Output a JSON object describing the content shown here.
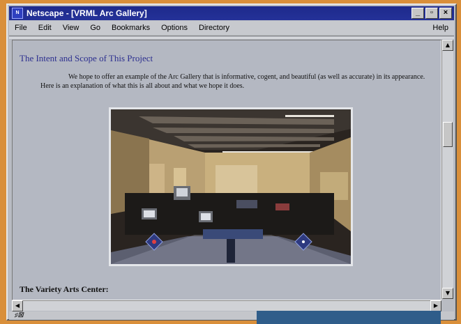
{
  "window": {
    "title": "Netscape - [VRML Arc Gallery]",
    "app_icon": "N",
    "controls": {
      "minimize": "_",
      "maximize": "▫",
      "close": "×"
    }
  },
  "menu": {
    "items": [
      "File",
      "Edit",
      "View",
      "Go",
      "Bookmarks",
      "Options",
      "Directory"
    ],
    "help": "Help"
  },
  "page": {
    "heading": "The Intent and Scope of This Project",
    "intro": "We hope to offer an example of the Arc Gallery that is informative, cogent, and beautiful (as well as accurate) in its appearance. Here is an explanation of what this is all about and what we hope it does.",
    "subheading": "The Variety Arts Center:"
  },
  "status": {
    "icon": "netscape-security-key-icon",
    "text": "♯☒"
  },
  "colors": {
    "titlebar": "#1e2a8c",
    "heading": "#2c2f8f",
    "background": "#d98f3a"
  }
}
